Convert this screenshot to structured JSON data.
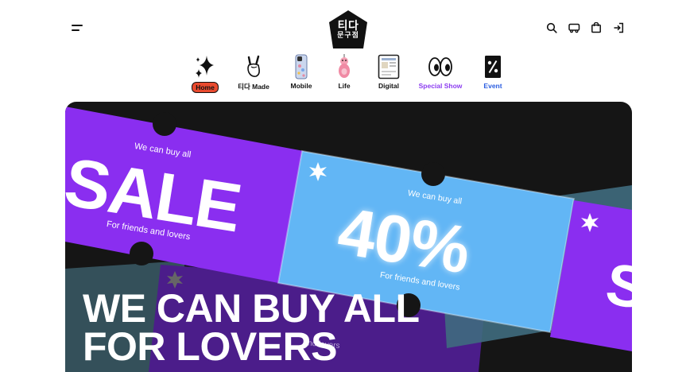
{
  "header": {
    "logo": {
      "line1": "티다",
      "line2": "문구점"
    },
    "icons": [
      "menu-icon",
      "search-icon",
      "delivery-icon",
      "bag-icon",
      "login-icon"
    ]
  },
  "nav": {
    "items": [
      {
        "label": "Home",
        "icon": "sparkle-icon",
        "active": true
      },
      {
        "label": "티다 Made",
        "icon": "rock-hand-icon"
      },
      {
        "label": "Mobile",
        "icon": "phone-case-icon"
      },
      {
        "label": "Life",
        "icon": "pink-figure-icon"
      },
      {
        "label": "Digital",
        "icon": "tablet-icon"
      },
      {
        "label": "Special Show",
        "icon": "eyes-icon",
        "color": "#8b3cf0"
      },
      {
        "label": "Event",
        "icon": "percent-tag-icon",
        "color": "#2a5de0"
      }
    ]
  },
  "hero": {
    "ticket_sale": {
      "top": "We can buy all",
      "big": "SALE",
      "bottom": "For friends and lovers"
    },
    "ticket_40": {
      "top": "We can buy all",
      "big": "40%",
      "bottom": "For friends and lovers"
    },
    "ticket_partial": {
      "big": "S"
    },
    "ticket_back": {
      "bottom": "and lovers"
    },
    "headline_line1": "WE CAN BUY ALL",
    "headline_line2": "FOR LOVERS"
  },
  "colors": {
    "purple": "#8a2ef0",
    "sky": "#62b6f5",
    "dark": "#151515",
    "active": "#e84a2e"
  }
}
